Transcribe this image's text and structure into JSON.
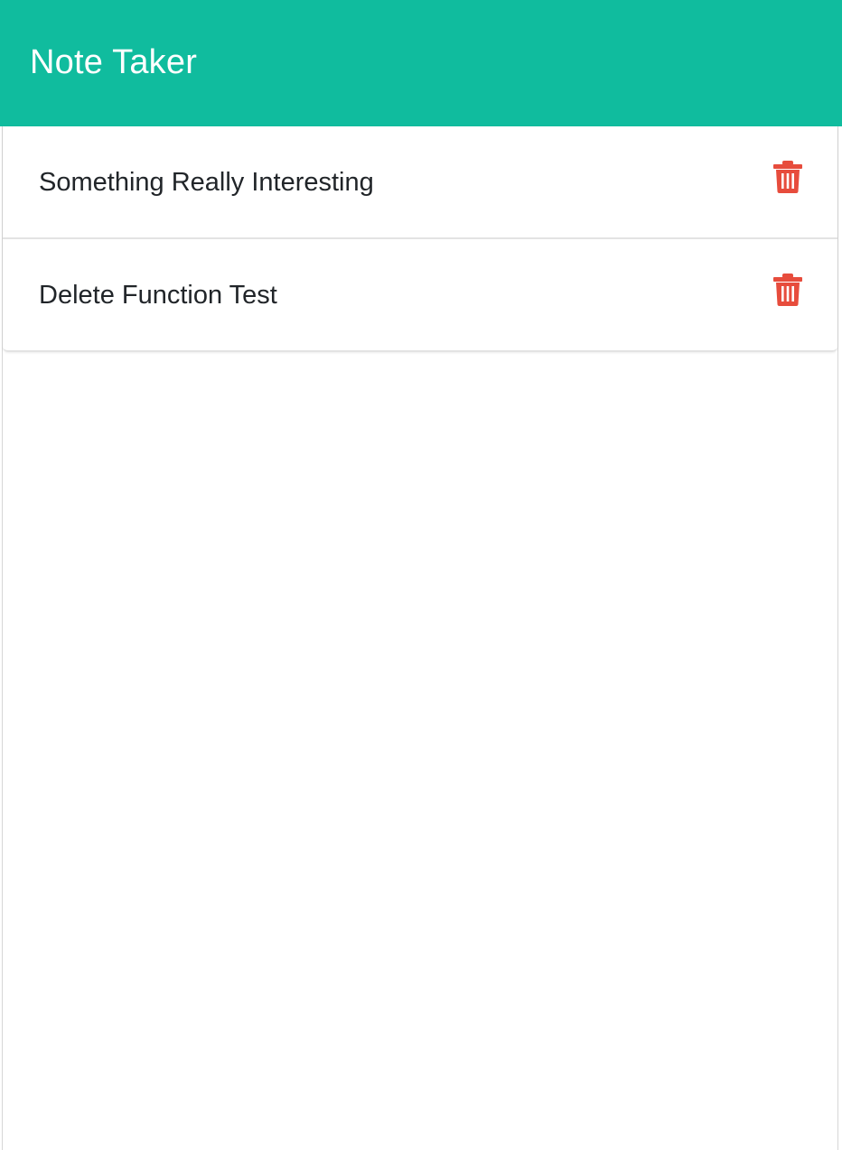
{
  "app": {
    "title": "Note Taker"
  },
  "colors": {
    "navbar_bg": "#10bc9e",
    "delete_icon": "#e74c3c",
    "text": "#212529"
  },
  "notes": [
    {
      "title": "Something Really Interesting",
      "delete_icon": "trash-icon"
    },
    {
      "title": "Delete Function Test",
      "delete_icon": "trash-icon"
    }
  ]
}
